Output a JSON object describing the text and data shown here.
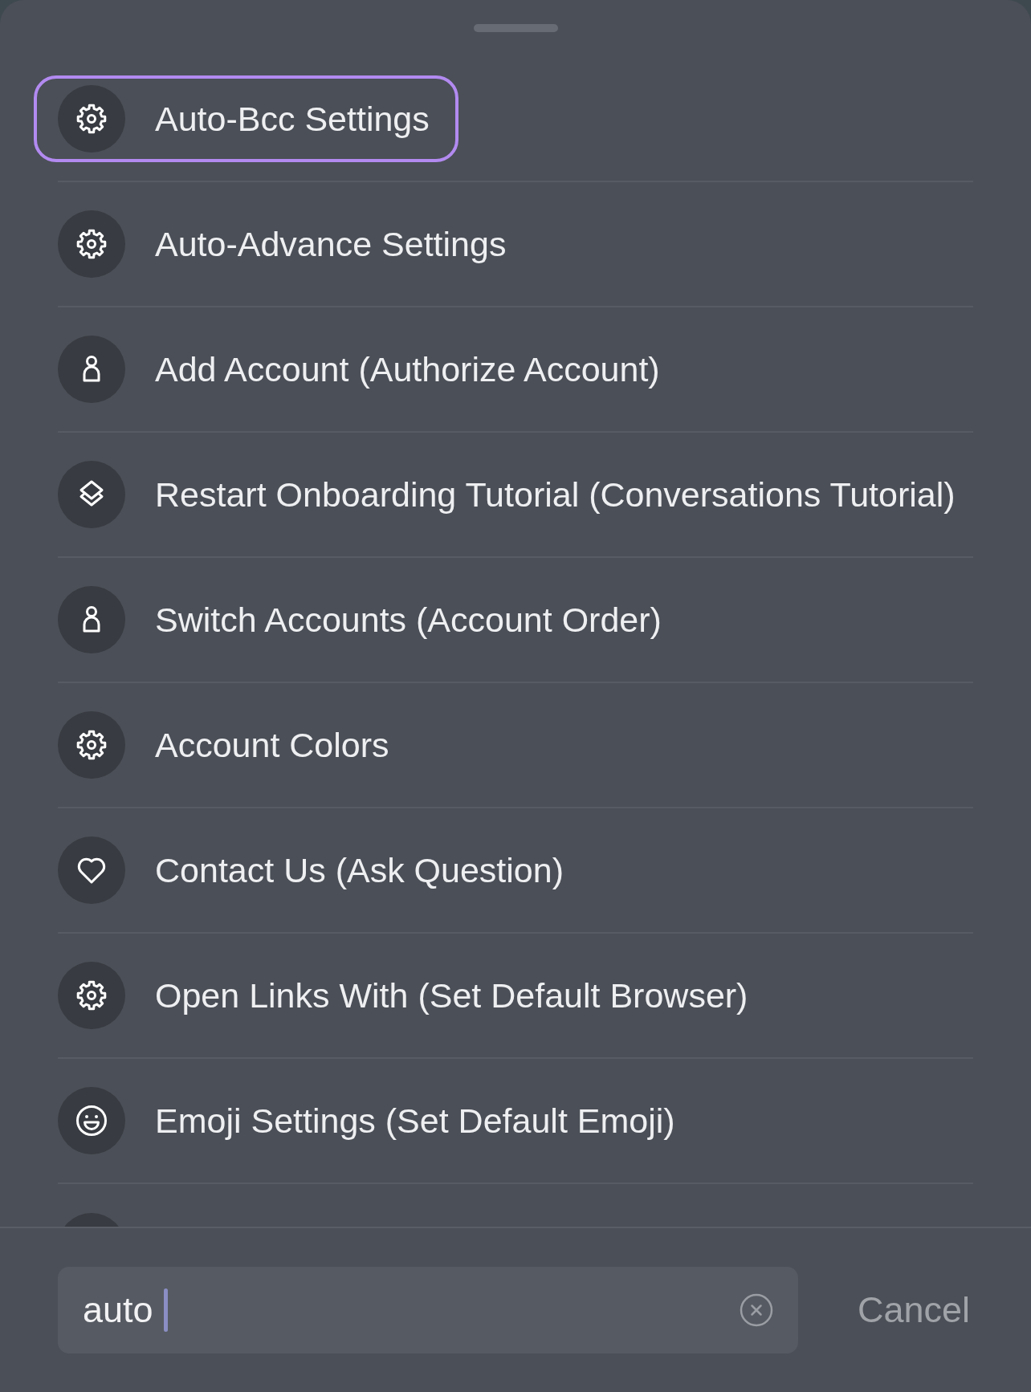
{
  "items": [
    {
      "label": "Auto-Bcc Settings",
      "kind": "settings",
      "selected": true
    },
    {
      "label": "Auto-Advance Settings",
      "kind": "settings",
      "selected": false
    },
    {
      "label": "Add Account (Authorize Account)",
      "kind": "account",
      "selected": false
    },
    {
      "label": "Restart Onboarding Tutorial (Conversations Tutorial)",
      "kind": "tutorial",
      "selected": false
    },
    {
      "label": "Switch Accounts (Account Order)",
      "kind": "account",
      "selected": false
    },
    {
      "label": "Account Colors",
      "kind": "settings",
      "selected": false
    },
    {
      "label": "Contact Us (Ask Question)",
      "kind": "support",
      "selected": false
    },
    {
      "label": "Open Links With (Set Default Browser)",
      "kind": "settings",
      "selected": false
    },
    {
      "label": "Emoji Settings (Set Default Emoji)",
      "kind": "emoji",
      "selected": false
    }
  ],
  "search": {
    "value": "auto",
    "focused": true
  },
  "cancel": "Cancel"
}
